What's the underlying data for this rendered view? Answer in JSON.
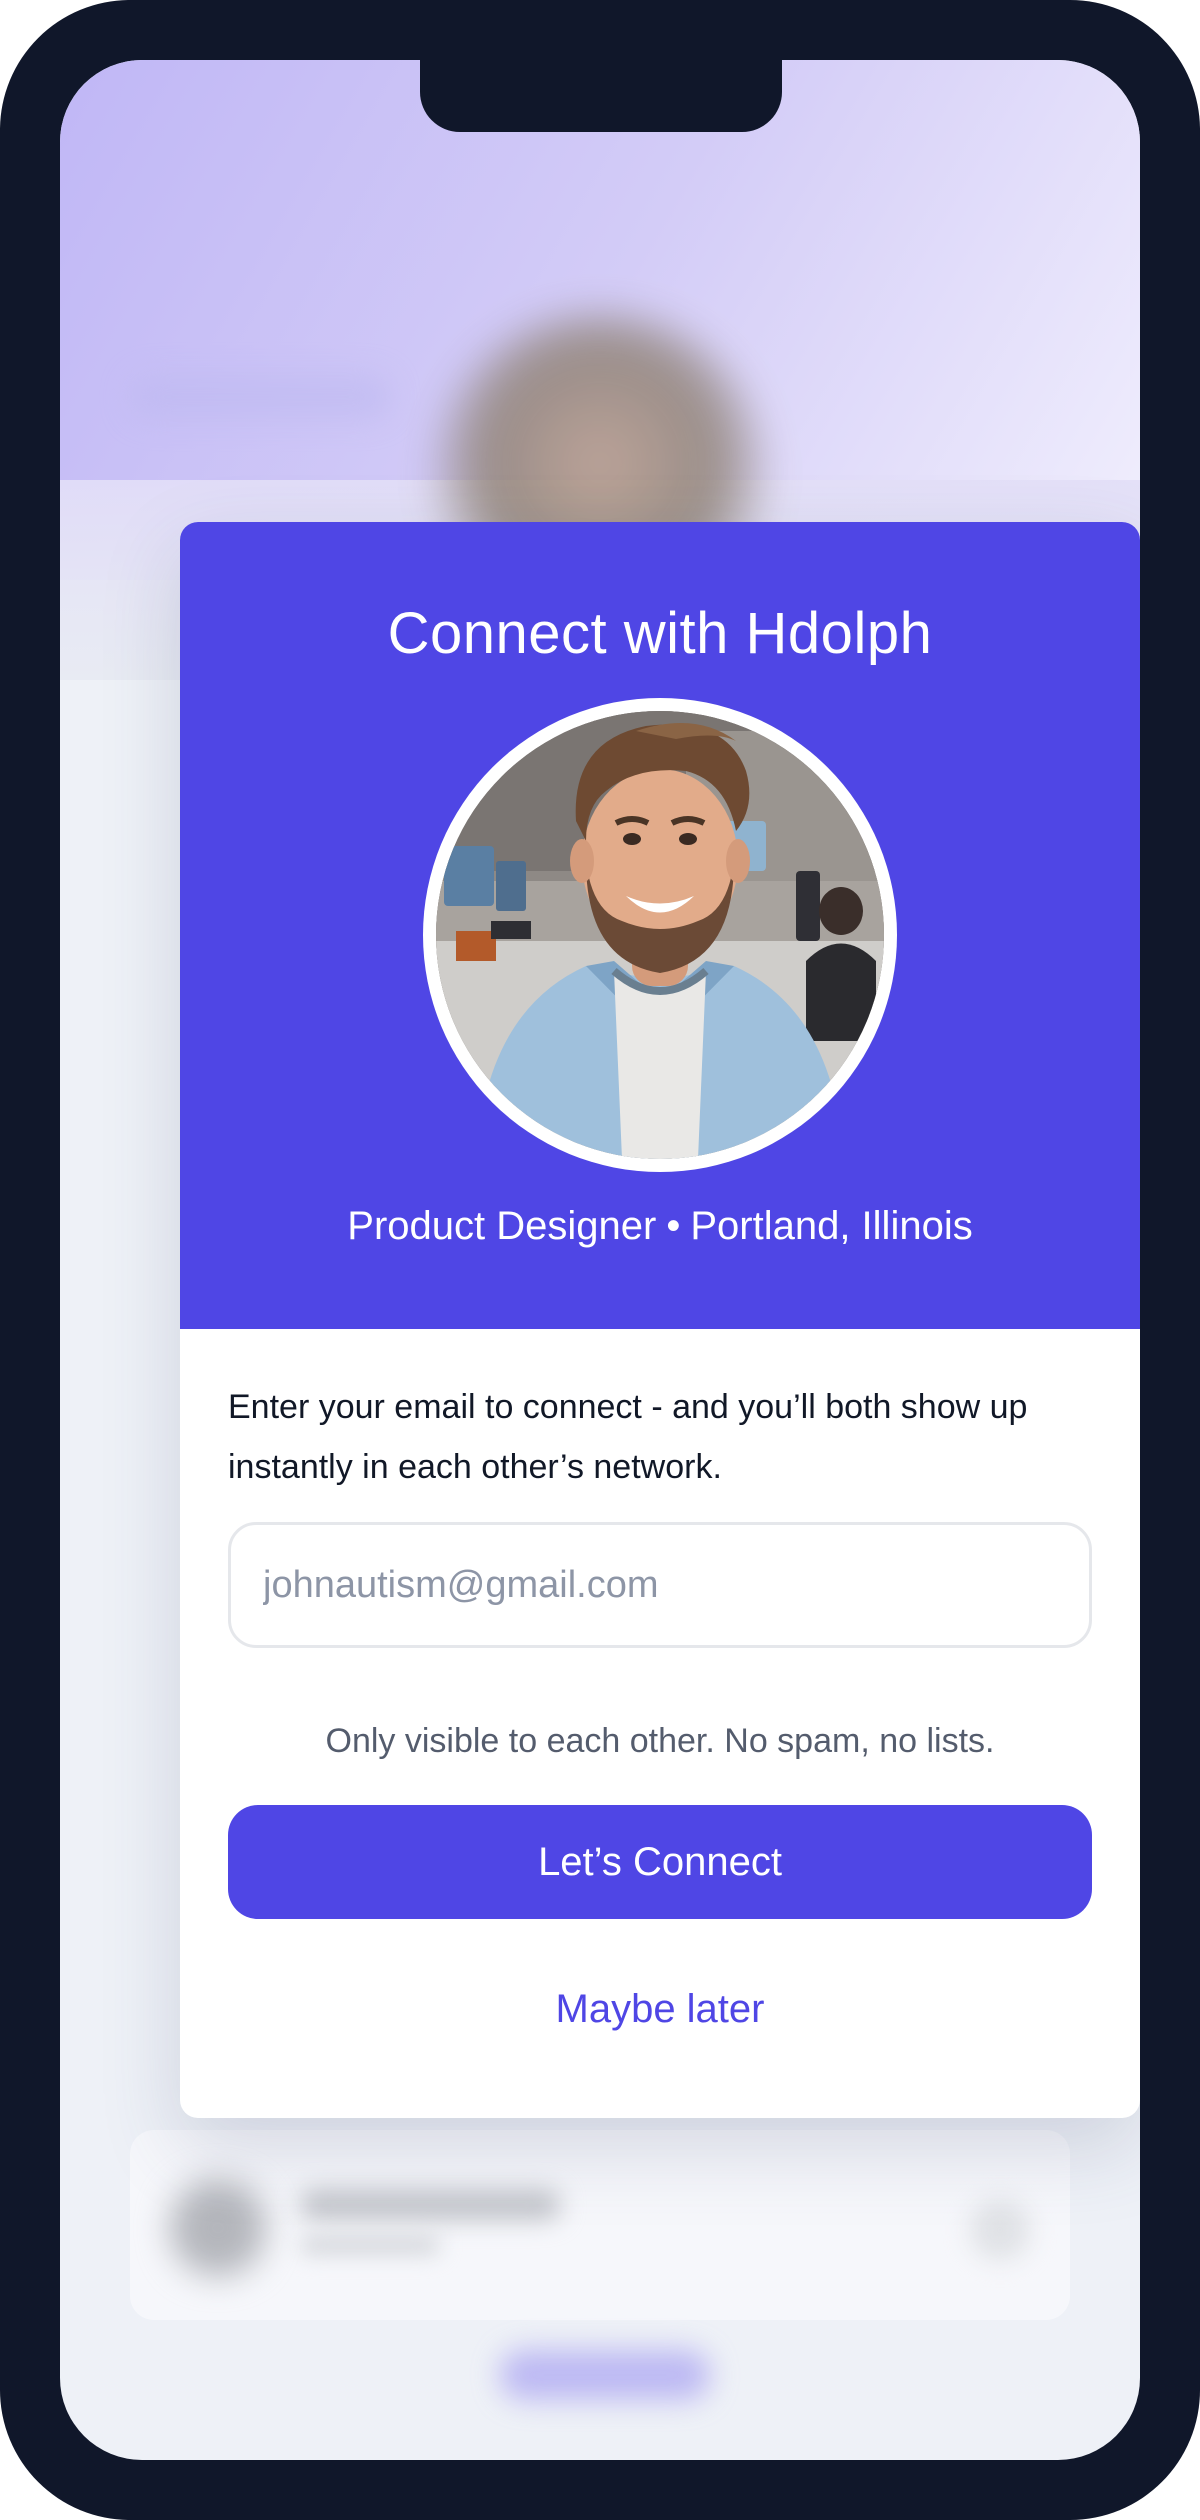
{
  "modal": {
    "title": "Connect with Hdolph",
    "profile": {
      "role": "Product Designer",
      "separator": "•",
      "location": "Portland, Illinois"
    },
    "prompt_text": "Enter your email to connect - and you’ll both show up instantly in each other’s network.",
    "email_input": {
      "placeholder": "johnautism@gmail.com",
      "value": ""
    },
    "privacy_note": "Only visible to each other. No spam, no lists.",
    "primary_button_label": "Let’s Connect",
    "secondary_link_label": "Maybe later"
  },
  "colors": {
    "accent": "#4f46e5",
    "device_frame": "#10172a",
    "text_primary": "#111827",
    "text_muted": "#545c6d",
    "placeholder": "#8d95a6"
  },
  "icons": {
    "avatar": "profile-photo"
  }
}
